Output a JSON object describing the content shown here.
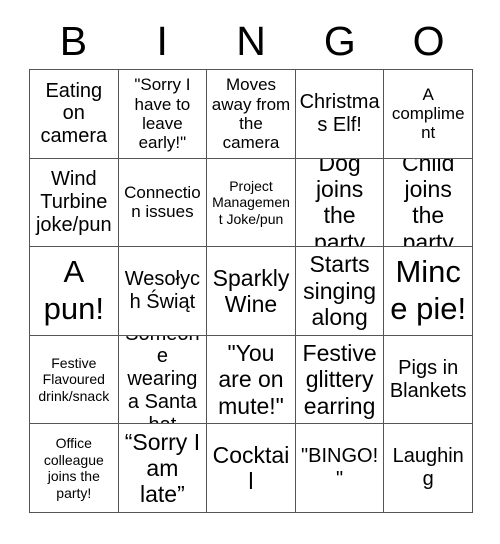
{
  "card": {
    "title": "BINGO",
    "header_letters": [
      "B",
      "I",
      "N",
      "G",
      "O"
    ],
    "grid_size": "5x5",
    "border_color": "#555555",
    "text_color": "#000000",
    "background_color": "#ffffff"
  },
  "cells": [
    {
      "text": "Eating on camera",
      "size": "lg"
    },
    {
      "text": "\"Sorry I have to leave early!\"",
      "size": "md"
    },
    {
      "text": "Moves away from the camera",
      "size": "md"
    },
    {
      "text": "Christmas Elf!",
      "size": "lg"
    },
    {
      "text": "A compliment",
      "size": "md"
    },
    {
      "text": "Wind Turbine joke/pun",
      "size": "lg"
    },
    {
      "text": "Connection issues",
      "size": "md"
    },
    {
      "text": "Project Management Joke/pun",
      "size": "sm"
    },
    {
      "text": "Dog joins the party",
      "size": "xl"
    },
    {
      "text": "Child joins the party",
      "size": "xl"
    },
    {
      "text": "A pun!",
      "size": "xxl"
    },
    {
      "text": "Wesołych Świąt",
      "size": "lg"
    },
    {
      "text": "Sparkly Wine",
      "size": "xl"
    },
    {
      "text": "Starts singing along",
      "size": "xl"
    },
    {
      "text": "Mince pie!",
      "size": "xxl"
    },
    {
      "text": "Festive Flavoured drink/snack",
      "size": "sm"
    },
    {
      "text": "Someone wearing a Santa hat",
      "size": "lg"
    },
    {
      "text": "\"You are on mute!\"",
      "size": "xl"
    },
    {
      "text": "Festive glittery earring",
      "size": "xl"
    },
    {
      "text": "Pigs in Blankets",
      "size": "lg"
    },
    {
      "text": "Office colleague joins the party!",
      "size": "sm"
    },
    {
      "text": "“Sorry I am late”",
      "size": "xl"
    },
    {
      "text": "Cocktail",
      "size": "xl"
    },
    {
      "text": "\"BINGO!\"",
      "size": "lg"
    },
    {
      "text": "Laughing",
      "size": "lg"
    }
  ]
}
